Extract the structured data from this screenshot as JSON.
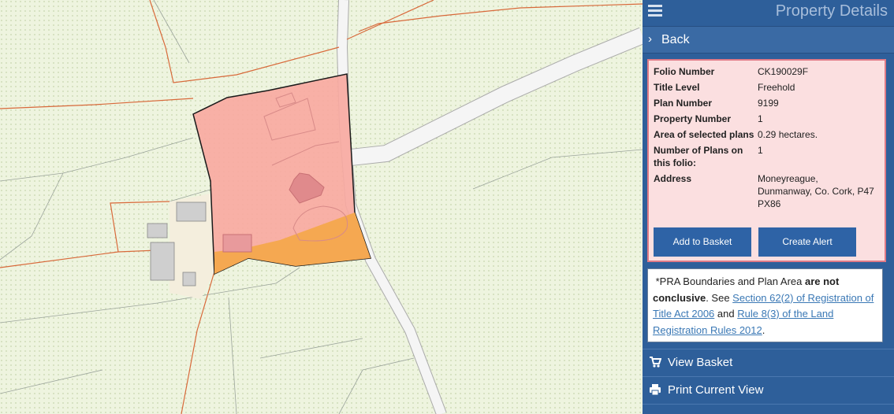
{
  "panel": {
    "title": "Property Details",
    "back_label": "Back",
    "details": [
      {
        "label": "Folio Number",
        "value": "CK190029F"
      },
      {
        "label": "Title Level",
        "value": "Freehold"
      },
      {
        "label": "Plan Number",
        "value": "9199"
      },
      {
        "label": "Property Number",
        "value": "1"
      },
      {
        "label": "Area of selected plans",
        "value": "0.29 hectares."
      },
      {
        "label": "Number of Plans on this folio:",
        "value": "1"
      },
      {
        "label": "Address",
        "value": "Moneyreague, Dunmanway, Co. Cork, P47 PX86"
      }
    ],
    "add_to_basket": "Add to Basket",
    "create_alert": "Create Alert",
    "note": {
      "prefix": "*PRA Boundaries and Plan Area ",
      "bold": "are not conclusive",
      "mid": ". See ",
      "link1": "Section 62(2) of Registration of Title Act 2006",
      "and": " and ",
      "link2": "Rule 8(3) of the Land Registration Rules 2012",
      "suffix": "."
    },
    "menu": [
      {
        "label": "View Basket",
        "icon": "cart-icon"
      },
      {
        "label": "Print Current View",
        "icon": "print-icon"
      }
    ]
  },
  "colors": {
    "panel_bg": "#2e5f9a",
    "parcel_fill": "#f8a8a0",
    "parcel_highlight": "#f5a851",
    "card_bg": "#fbdfe0",
    "card_border": "#e07a86"
  }
}
